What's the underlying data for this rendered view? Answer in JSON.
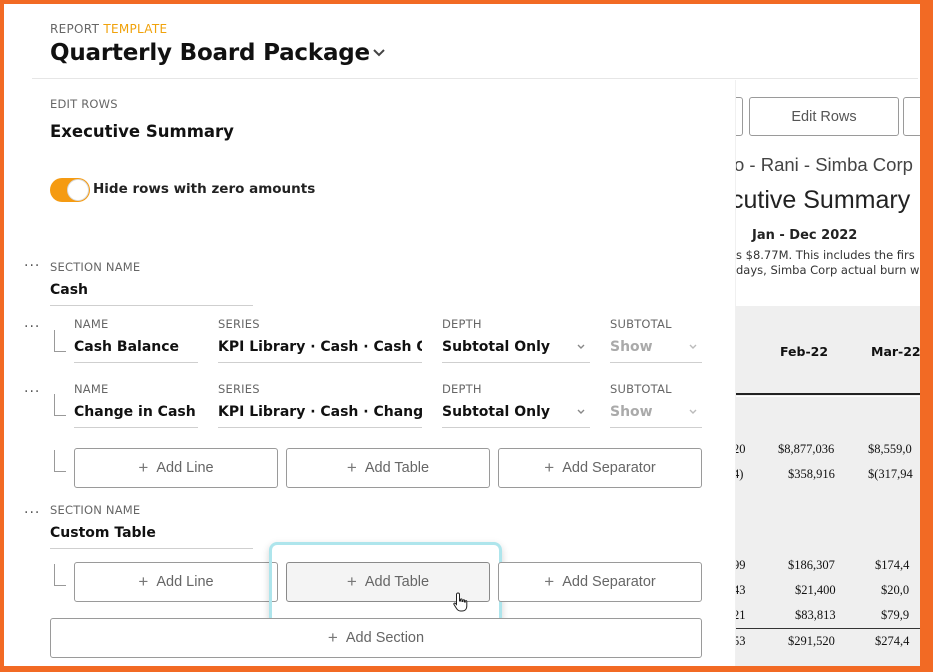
{
  "header": {
    "label_prefix": "REPORT",
    "label_accent": "TEMPLATE",
    "title": "Quarterly Board Package",
    "caret_icon": "chevron-down-icon"
  },
  "editor": {
    "edit_rows_label": "EDIT ROWS",
    "page_name": "Executive Summary",
    "toggle": {
      "label": "Hide rows with zero amounts",
      "on": true,
      "color": "#f59b12"
    },
    "sections": [
      {
        "name_label": "SECTION NAME",
        "name": "Cash",
        "rows": [
          {
            "name_label": "NAME",
            "name": "Cash Balance",
            "series_label": "SERIES",
            "series": "KPI Library · Cash · Cash O...",
            "depth_label": "DEPTH",
            "depth": "Subtotal Only",
            "subtotal_label": "SUBTOTAL",
            "subtotal": "Show"
          },
          {
            "name_label": "NAME",
            "name": "Change in Cash",
            "series_label": "SERIES",
            "series": "KPI Library · Cash · Change...",
            "depth_label": "DEPTH",
            "depth": "Subtotal Only",
            "subtotal_label": "SUBTOTAL",
            "subtotal": "Show"
          }
        ],
        "buttons": {
          "add_line": "Add Line",
          "add_table": "Add Table",
          "add_separator": "Add Separator"
        }
      },
      {
        "name_label": "SECTION NAME",
        "name": "Custom Table",
        "buttons": {
          "add_line": "Add Line",
          "add_table": "Add Table",
          "add_separator": "Add Separator"
        }
      }
    ],
    "add_section": "Add Section",
    "more_icon": "more-dots-icon"
  },
  "preview": {
    "btn_left_label": "",
    "btn_edit_rows": "Edit Rows",
    "company_line": "o - Rani - Simba Corp",
    "title": "cutive Summary",
    "period": "Jan - Dec 2022",
    "desc1": "s $8.77M. This includes the firs",
    "desc2": "days, Simba Corp actual burn w",
    "col_headers": [
      "Feb-22",
      "Mar-22"
    ],
    "rows": [
      {
        "left": "20",
        "feb": "$8,877,036",
        "mar": "$8,559,0"
      },
      {
        "left": "4)",
        "feb": "$358,916",
        "mar": "$(317,94"
      },
      {
        "left": "99",
        "feb": "$186,307",
        "mar": "$174,4"
      },
      {
        "left": "43",
        "feb": "$21,400",
        "mar": "$20,0"
      },
      {
        "left": "21",
        "feb": "$83,813",
        "mar": "$79,9"
      },
      {
        "left": "53",
        "feb": "$291,520",
        "mar": "$274,4"
      }
    ]
  },
  "colors": {
    "frame": "#f26a24",
    "accent_text": "#f0a20b",
    "highlight": "#aee5ec"
  }
}
